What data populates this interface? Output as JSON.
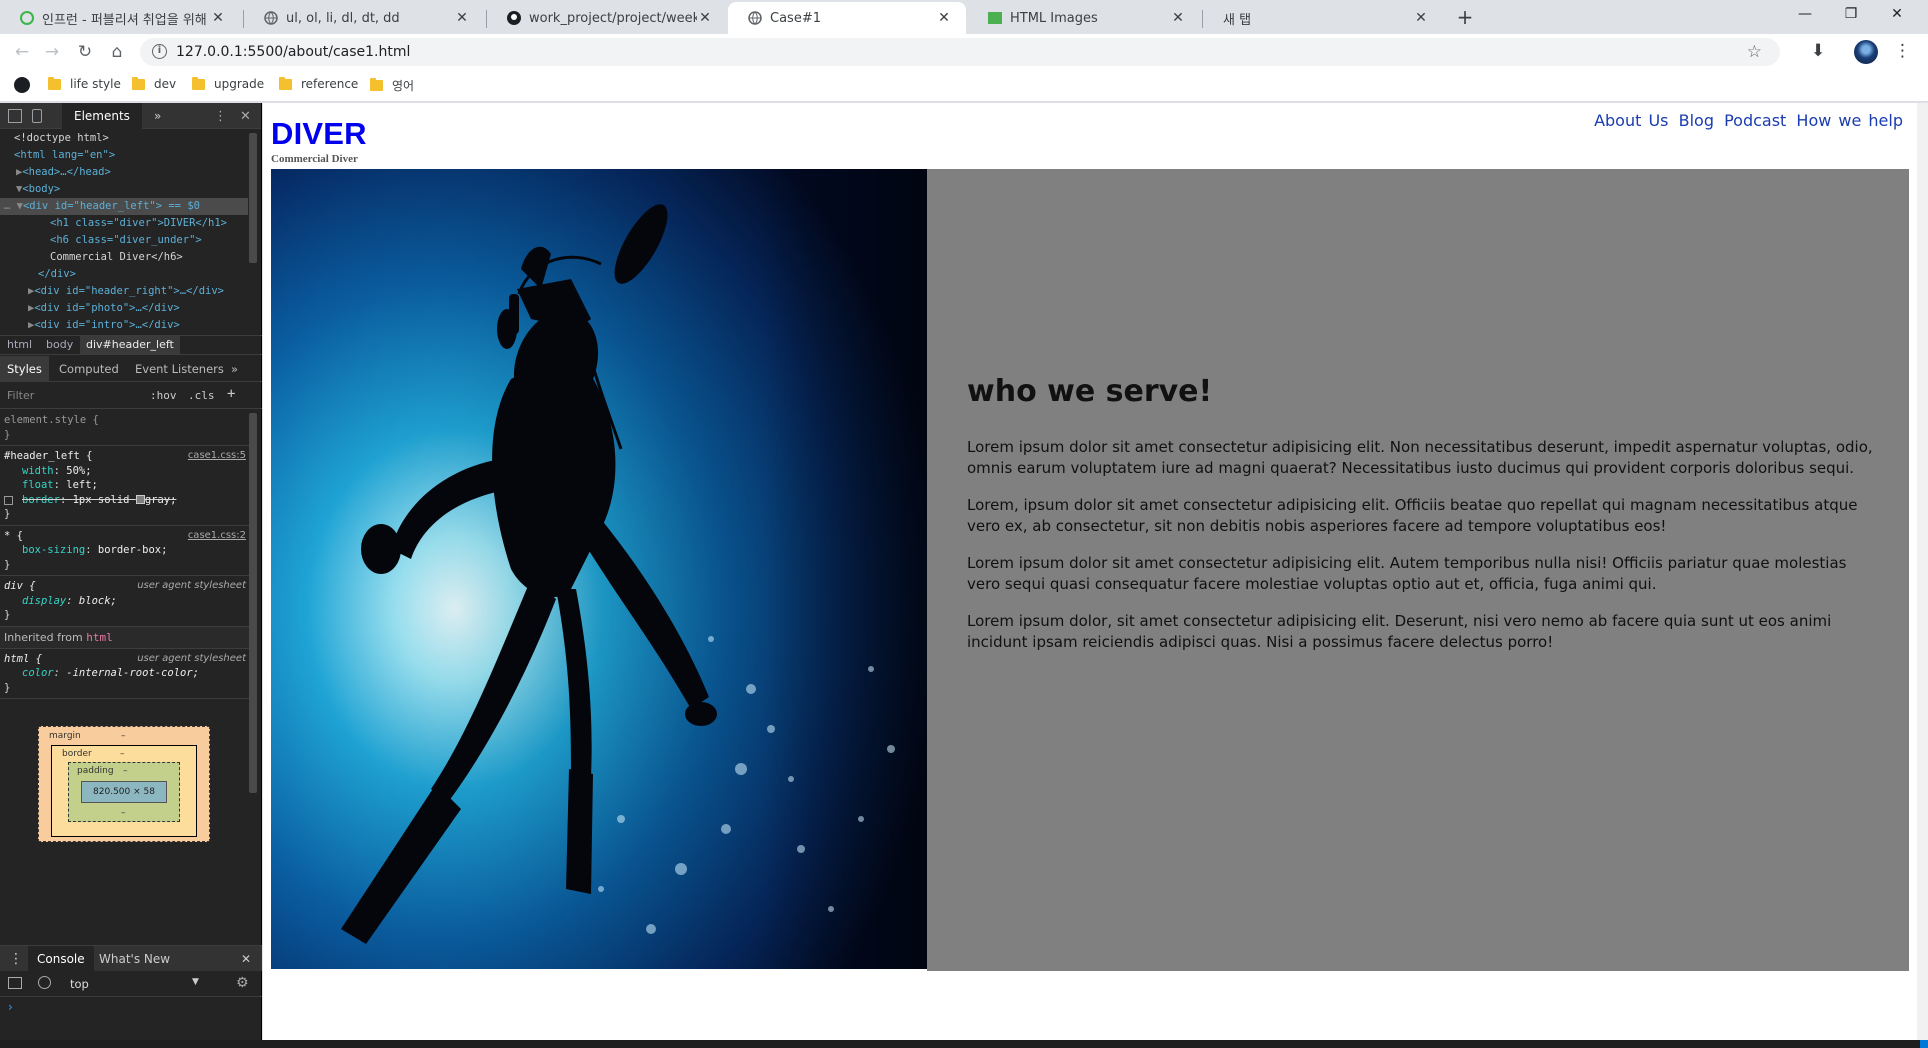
{
  "browser": {
    "tabs": [
      {
        "title": "인프런 - 퍼블리셔 취업을 위해",
        "icon": "inflearn-icon",
        "active": false
      },
      {
        "title": "ul, ol, li, dl, dt, dd",
        "icon": "globe-icon",
        "active": false
      },
      {
        "title": "work_project/project/week2 at",
        "icon": "github-icon",
        "active": false
      },
      {
        "title": "Case#1",
        "icon": "globe-icon",
        "active": true
      },
      {
        "title": "HTML Images",
        "icon": "w3schools-icon",
        "active": false
      },
      {
        "title": "새 탭",
        "icon": "",
        "active": false
      }
    ],
    "url": "127.0.0.1:5500/about/case1.html",
    "bookmarks": [
      "life style",
      "dev",
      "upgrade",
      "reference",
      "영어"
    ]
  },
  "devtools": {
    "main_tab": "Elements",
    "dom_lines": [
      "<!doctype html>",
      "<html lang=\"en\">",
      "<head>…</head>",
      "<body>",
      "<div id=\"header_left\"> == $0",
      "<h1 class=\"diver\">DIVER</h1>",
      "<h6 class=\"diver_under\">",
      "Commercial Diver</h6>",
      "</div>",
      "<div id=\"header_right\">…</div>",
      "<div id=\"photo\">…</div>",
      "<div id=\"intro\">…</div>"
    ],
    "breadcrumbs": [
      "html",
      "body",
      "div#header_left"
    ],
    "sub_tabs": [
      "Styles",
      "Computed",
      "Event Listeners"
    ],
    "filter_placeholder": "Filter",
    "hov": ":hov",
    "cls": ".cls",
    "rules": {
      "element_style": "element.style {",
      "header_left": {
        "selector": "#header_left {",
        "source": "case1.css:5",
        "width": "50%;",
        "float": "left;",
        "border": "1px solid",
        "border_color": "gray;"
      },
      "universal": {
        "selector": "* {",
        "source": "case1.css:2",
        "box_sizing": "border-box;"
      },
      "div": {
        "selector": "div {",
        "source": "user agent stylesheet",
        "display": "block;"
      },
      "inherited_label": "Inherited from",
      "inherited_from": "html",
      "html": {
        "selector": "html {",
        "source": "user agent stylesheet",
        "color": "-internal-root-color;"
      }
    },
    "box_model": {
      "margin": "margin",
      "border": "border",
      "padding": "padding",
      "content": "820.500 × 58",
      "dash": "–"
    },
    "console_tabs": [
      "Console",
      "What's New"
    ],
    "context": "top"
  },
  "page": {
    "logo": "DIVER",
    "subtitle": "Commercial Diver",
    "nav": [
      "About Us",
      "Blog",
      "Podcast",
      "How we help"
    ],
    "intro_heading": "who we serve!",
    "paragraphs": [
      "Lorem ipsum dolor sit amet consectetur adipisicing elit. Non necessitatibus deserunt, impedit aspernatur voluptas, odio, omnis earum voluptatem iure ad magni quaerat? Necessitatibus iusto ducimus qui provident corporis doloribus sequi.",
      "Lorem, ipsum dolor sit amet consectetur adipisicing elit. Officiis beatae quo repellat qui magnam necessitatibus atque vero ex, ab consectetur, sit non debitis nobis asperiores facere ad tempore voluptatibus eos!",
      "Lorem ipsum dolor sit amet consectetur adipisicing elit. Autem temporibus nulla nisi! Officiis pariatur quae molestias vero sequi quasi consequatur facere molestiae voluptas optio aut et, officia, fuga animi qui.",
      "Lorem ipsum dolor, sit amet consectetur adipisicing elit. Deserunt, nisi vero nemo ab facere quia sunt ut eos animi incidunt ipsam reiciendis adipisci quas. Nisi a possimus facere delectus porro!"
    ],
    "colors": {
      "logo": "#0000ee",
      "intro_bg": "#808080",
      "nav_link": "#1a3cb0"
    }
  }
}
